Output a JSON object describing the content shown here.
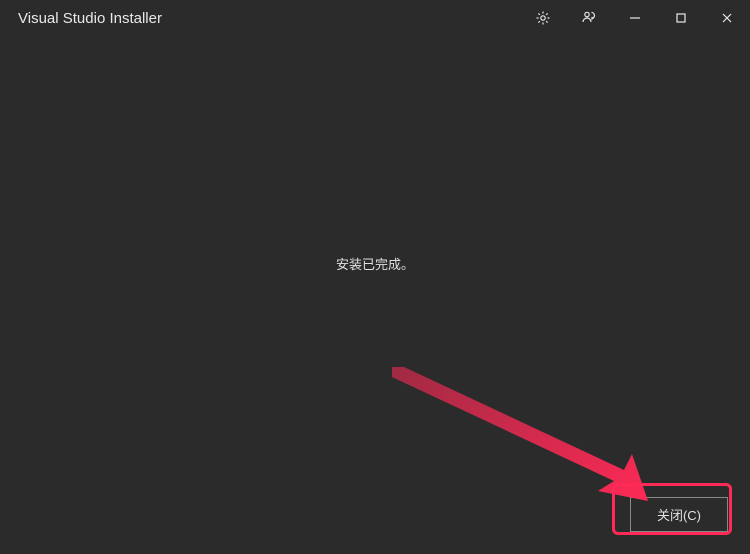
{
  "window": {
    "title": "Visual Studio Installer"
  },
  "main": {
    "status_message": "安装已完成。"
  },
  "footer": {
    "close_label": "关闭(C)"
  },
  "annotation": {
    "arrow_color": "#ff2a56",
    "box_color": "#ff2a56"
  }
}
